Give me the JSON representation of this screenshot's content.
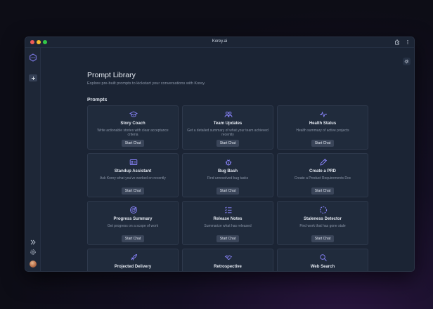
{
  "window": {
    "title": "Korey.ai"
  },
  "page": {
    "title": "Prompt Library",
    "subtitle": "Explore pre-built prompts to kickstart your conversations with Korey.",
    "section": "Prompts"
  },
  "colors": {
    "accent": "#8b86ff",
    "background": "#1b2434",
    "card": "#202b3c"
  },
  "cards": [
    {
      "title": "Story Coach",
      "desc": "Write actionable stories with clear acceptance criteria",
      "button": "Start Chat",
      "icon": "graduation-cap-icon"
    },
    {
      "title": "Team Updates",
      "desc": "Get a detailed summary of what your team achieved recently",
      "button": "Start Chat",
      "icon": "users-icon"
    },
    {
      "title": "Health Status",
      "desc": "Health summary of active projects",
      "button": "Start Chat",
      "icon": "pulse-icon"
    },
    {
      "title": "Standup Assistant",
      "desc": "Ask Korey what you've worked on recently",
      "button": "Start Chat",
      "icon": "id-card-icon"
    },
    {
      "title": "Bug Bash",
      "desc": "Find unresolved bug tasks",
      "button": "Start Chat",
      "icon": "bug-icon"
    },
    {
      "title": "Create a PRD",
      "desc": "Create a Product Requirements Doc",
      "button": "Start Chat",
      "icon": "pencil-icon"
    },
    {
      "title": "Progress Summary",
      "desc": "Get progress on a scope of work",
      "button": "Start Chat",
      "icon": "target-icon"
    },
    {
      "title": "Release Notes",
      "desc": "Summarize what has released",
      "button": "Start Chat",
      "icon": "list-icon"
    },
    {
      "title": "Staleness Detector",
      "desc": "Find work that has gone stale",
      "button": "Start Chat",
      "icon": "dashed-circle-icon"
    },
    {
      "title": "Projected Delivery",
      "desc": "",
      "button": "",
      "icon": "rocket-icon"
    },
    {
      "title": "Retrospective",
      "desc": "",
      "button": "",
      "icon": "handshake-icon"
    },
    {
      "title": "Web Search",
      "desc": "",
      "button": "",
      "icon": "search-icon"
    }
  ]
}
